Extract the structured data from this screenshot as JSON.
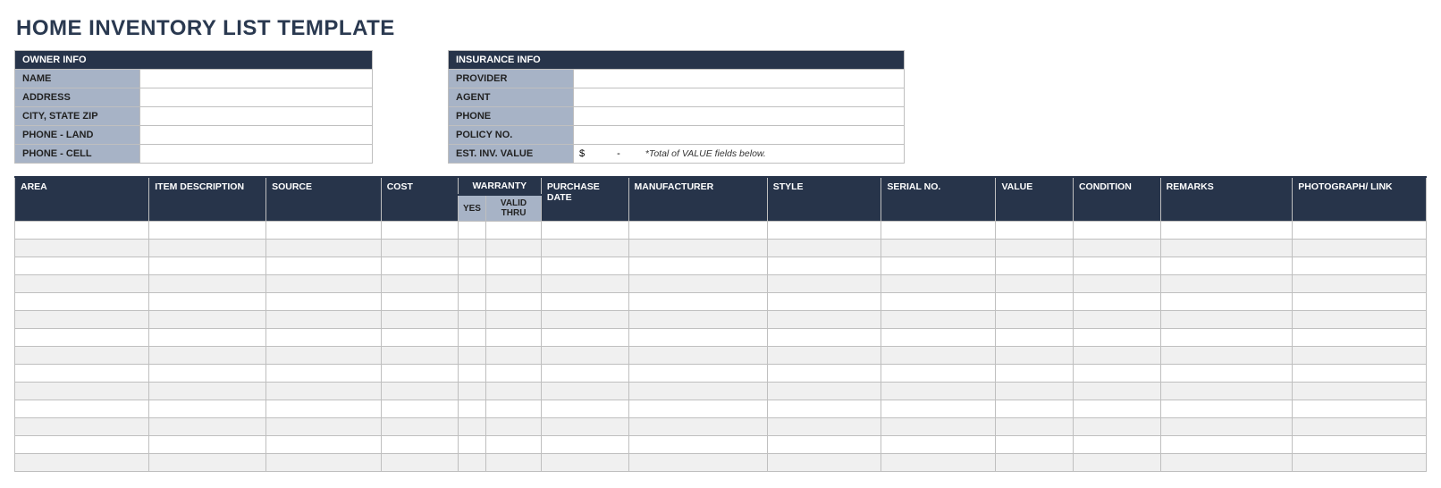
{
  "title": "HOME INVENTORY LIST TEMPLATE",
  "owner": {
    "header": "OWNER INFO",
    "labels": {
      "name": "NAME",
      "address": "ADDRESS",
      "city": "CITY, STATE ZIP",
      "phone_land": "PHONE - LAND",
      "phone_cell": "PHONE - CELL"
    },
    "values": {
      "name": "",
      "address": "",
      "city": "",
      "phone_land": "",
      "phone_cell": ""
    }
  },
  "insurance": {
    "header": "INSURANCE INFO",
    "labels": {
      "provider": "PROVIDER",
      "agent": "AGENT",
      "phone": "PHONE",
      "policy": "POLICY NO.",
      "est": "EST. INV. VALUE"
    },
    "values": {
      "provider": "",
      "agent": "",
      "phone": "",
      "policy": "",
      "est_symbol": "$",
      "est_dash": "-",
      "est_note": "*Total of VALUE fields below."
    }
  },
  "columns": {
    "area": "AREA",
    "item": "ITEM DESCRIPTION",
    "source": "SOURCE",
    "cost": "COST",
    "warranty": "WARRANTY",
    "warranty_yes": "YES",
    "warranty_valid": "VALID THRU",
    "purchase": "PURCHASE DATE",
    "manufacturer": "MANUFACTURER",
    "style": "STYLE",
    "serial": "SERIAL NO.",
    "value": "VALUE",
    "condition": "CONDITION",
    "remarks": "REMARKS",
    "photo": "PHOTOGRAPH/ LINK"
  },
  "row_count": 14
}
